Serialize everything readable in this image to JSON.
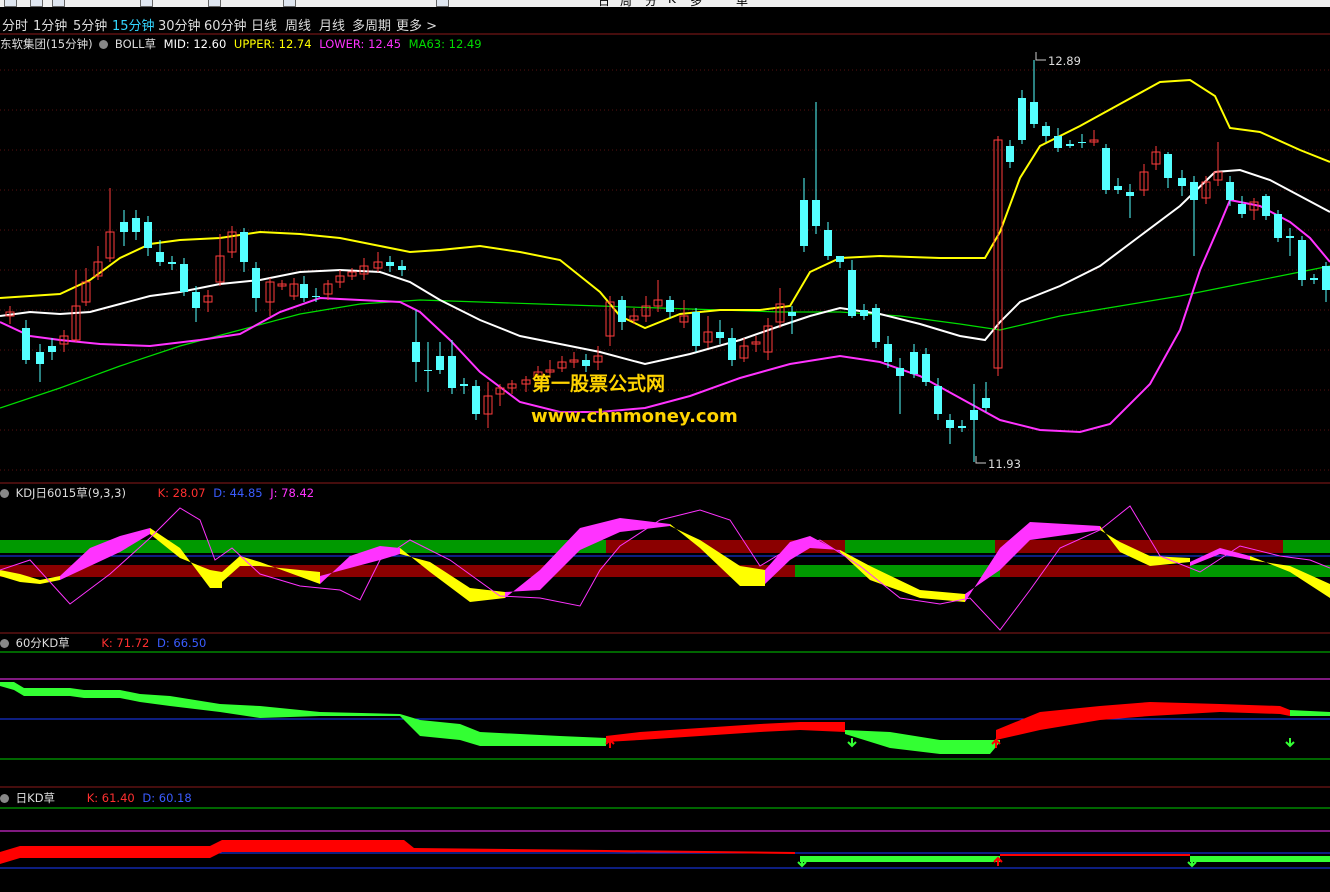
{
  "periods": [
    {
      "label": "分时",
      "active": false
    },
    {
      "label": "1分钟",
      "active": false
    },
    {
      "label": "5分钟",
      "active": false
    },
    {
      "label": "15分钟",
      "active": true
    },
    {
      "label": "30分钟",
      "active": false
    },
    {
      "label": "60分钟",
      "active": false
    },
    {
      "label": "日线",
      "active": false
    },
    {
      "label": "周线",
      "active": false
    },
    {
      "label": "月线",
      "active": false
    },
    {
      "label": "多周期",
      "active": false
    },
    {
      "label": "更多 >",
      "active": false
    }
  ],
  "toolbar_partial_text": [
    "日",
    "周",
    "分",
    "K",
    "多",
    "单"
  ],
  "main_panel": {
    "stock": "东软集团(15分钟)",
    "indicator": "BOLL草",
    "mid": "MID: 12.60",
    "upper": "UPPER: 12.74",
    "lower": "LOWER: 12.45",
    "ma": "MA63: 12.49",
    "high_label": "12.89",
    "low_label": "11.93"
  },
  "kdj_panel": {
    "name": "KDJ日6015草(9,3,3)",
    "k": "K: 28.07",
    "d": "D: 44.85",
    "j": "J: 78.42"
  },
  "kd60_panel": {
    "name": "60分KD草",
    "k": "K: 71.72",
    "d": "D: 66.50"
  },
  "kdday_panel": {
    "name": "日KD草",
    "k": "K: 61.40",
    "d": "D: 60.18"
  },
  "watermark": {
    "line1": "第一股票公式网",
    "line2": "www.chnmoney.com"
  },
  "colors": {
    "up": "#ff3d3d",
    "down": "#54ffff",
    "upper": "#ffff00",
    "mid": "#ffffff",
    "lower": "#ff33ff",
    "ma63": "#00dd00",
    "k_label": "#ff3030",
    "d_label": "#3a5cff",
    "j_label": "#ff33ff"
  },
  "icons": [
    "window-icon",
    "arrow-icon",
    "chart-icon",
    "zoom-icon",
    "pan-icon",
    "draw-icon",
    "grid-icon"
  ]
}
